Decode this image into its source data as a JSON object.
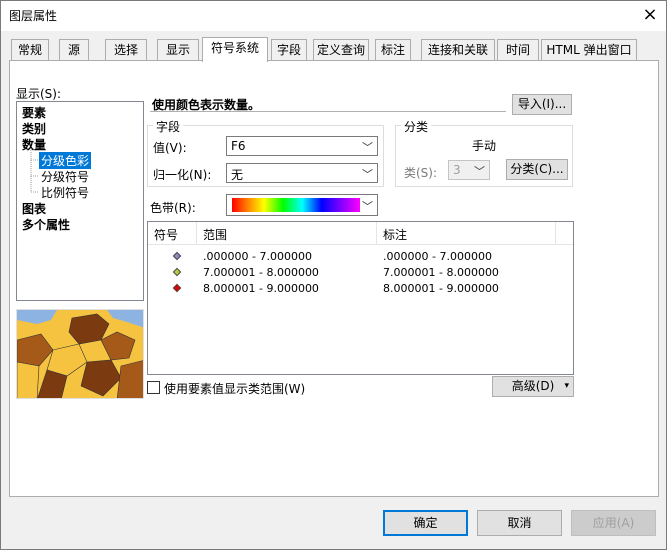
{
  "window": {
    "title": "图层属性",
    "close": "×"
  },
  "tabs": [
    "常规",
    "源",
    "选择",
    "显示",
    "符号系统",
    "字段",
    "定义查询",
    "标注",
    "连接和关联",
    "时间",
    "HTML 弹出窗口"
  ],
  "active_tab": "符号系统",
  "show": {
    "label": "显示(S):",
    "tree": [
      "要素",
      "类别",
      "数量",
      "分级色彩",
      "分级符号",
      "比例符号",
      "图表",
      "多个属性"
    ],
    "selected": "分级色彩"
  },
  "header": {
    "text": "使用颜色表示数量。",
    "import_button": "导入(I)..."
  },
  "fields_group": {
    "title": "字段",
    "value_label": "值(V):",
    "value": "F6",
    "normalize_label": "归一化(N):",
    "normalize": "无"
  },
  "classification_group": {
    "title": "分类",
    "method": "手动",
    "classes_label": "类(S):",
    "classes": "3",
    "classify_button": "分类(C)..."
  },
  "color_ramp_label": "色带(R):",
  "table": {
    "headers": [
      "符号",
      "范围",
      "标注"
    ],
    "rows": [
      {
        "color": "#8c8cc8",
        "range": ".000000 - 7.000000",
        "label": ".000000 - 7.000000"
      },
      {
        "color": "#b4d23c",
        "range": "7.000001 - 8.000000",
        "label": "7.000001 - 8.000000"
      },
      {
        "color": "#e60000",
        "range": "8.000001 - 9.000000",
        "label": "8.000001 - 9.000000"
      }
    ]
  },
  "use_feature_values": "使用要素值显示类范围(W)",
  "advanced_button": "高级(D)",
  "footer": {
    "ok": "确定",
    "cancel": "取消",
    "apply": "应用(A)"
  }
}
